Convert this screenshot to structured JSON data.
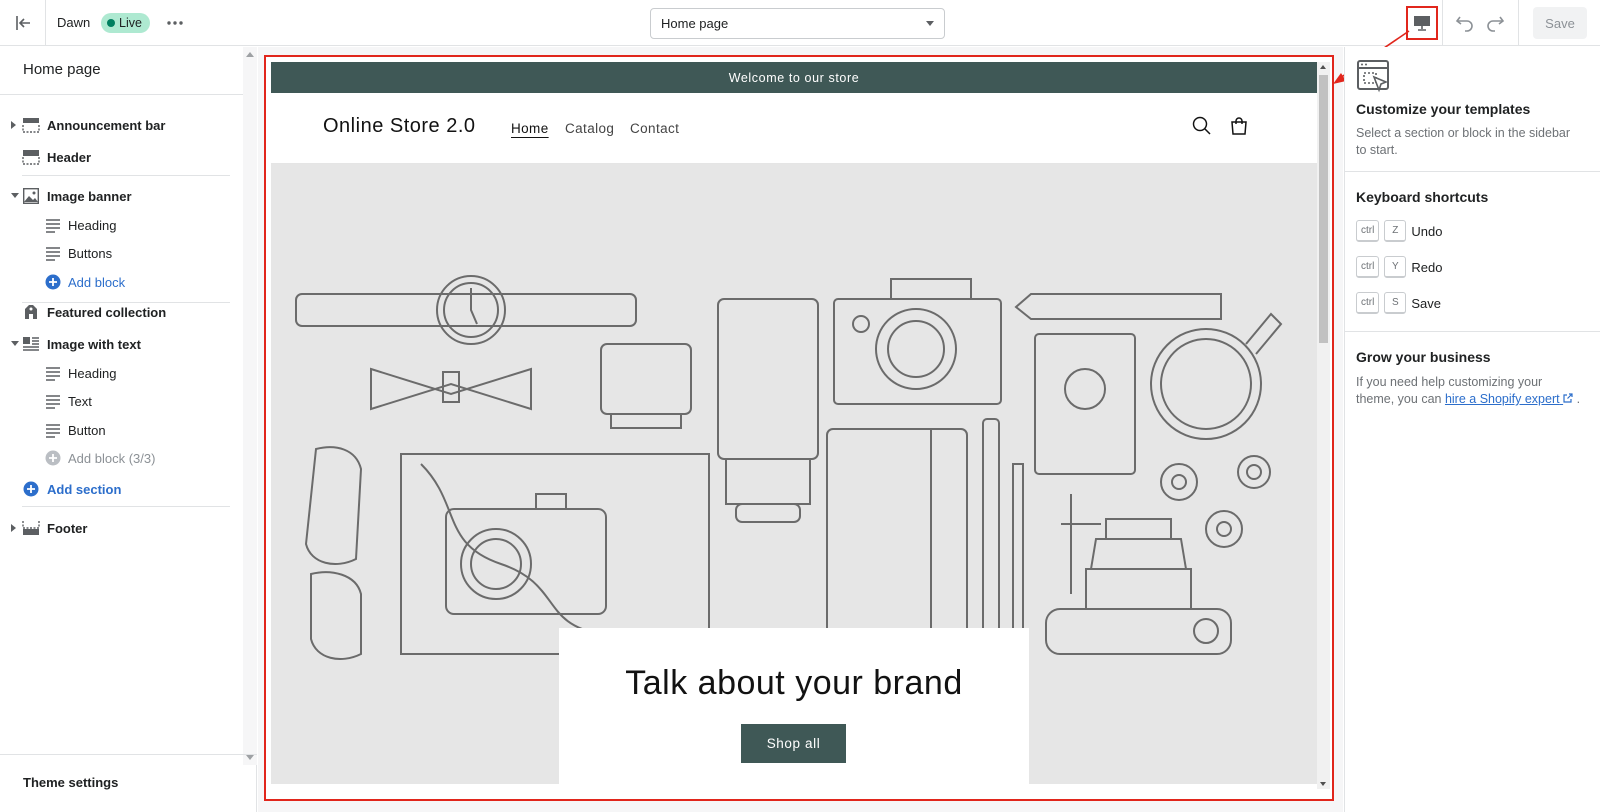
{
  "topbar": {
    "theme_name": "Dawn",
    "live_badge": "Live",
    "page_select_value": "Home page",
    "save_label": "Save"
  },
  "sidebar": {
    "title": "Home page",
    "items": [
      {
        "label": "Announcement bar",
        "icon": "announcement-bar-icon"
      },
      {
        "label": "Header",
        "icon": "header-section-icon"
      },
      {
        "label": "Image banner",
        "icon": "image-icon"
      },
      {
        "label": "Heading",
        "icon": "text-lines-icon"
      },
      {
        "label": "Buttons",
        "icon": "text-lines-icon"
      },
      {
        "label": "Add block",
        "icon": "plus-circle-icon"
      },
      {
        "label": "Featured collection",
        "icon": "tag-icon"
      },
      {
        "label": "Image with text",
        "icon": "image-with-text-icon"
      },
      {
        "label": "Heading",
        "icon": "text-lines-icon"
      },
      {
        "label": "Text",
        "icon": "text-lines-icon"
      },
      {
        "label": "Button",
        "icon": "text-lines-icon"
      },
      {
        "label": "Add block (3/3)",
        "icon": "plus-circle-icon"
      },
      {
        "label": "Add section",
        "icon": "plus-circle-icon"
      },
      {
        "label": "Footer",
        "icon": "footer-section-icon"
      }
    ],
    "footer_label": "Theme settings"
  },
  "preview": {
    "announcement": "Welcome to our store",
    "store_name": "Online Store 2.0",
    "nav": [
      "Home",
      "Catalog",
      "Contact"
    ],
    "banner_heading": "Talk about your brand",
    "banner_button": "Shop all"
  },
  "right_panel": {
    "customize_title": "Customize your templates",
    "customize_text": "Select a section or block in the sidebar to start.",
    "shortcuts_title": "Keyboard shortcuts",
    "shortcuts": [
      {
        "mod": "ctrl",
        "key": "Z",
        "action": "Undo"
      },
      {
        "mod": "ctrl",
        "key": "Y",
        "action": "Redo"
      },
      {
        "mod": "ctrl",
        "key": "S",
        "action": "Save"
      }
    ],
    "grow_title": "Grow your business",
    "grow_text_before": "If you need help customizing your theme, you can",
    "grow_link": "hire a Shopify expert",
    "grow_text_after": "."
  },
  "colors": {
    "accent_red": "#e1261c",
    "brand_teal": "#3f5856",
    "link_blue": "#2c6ecb",
    "live_green": "#aee9d1"
  }
}
